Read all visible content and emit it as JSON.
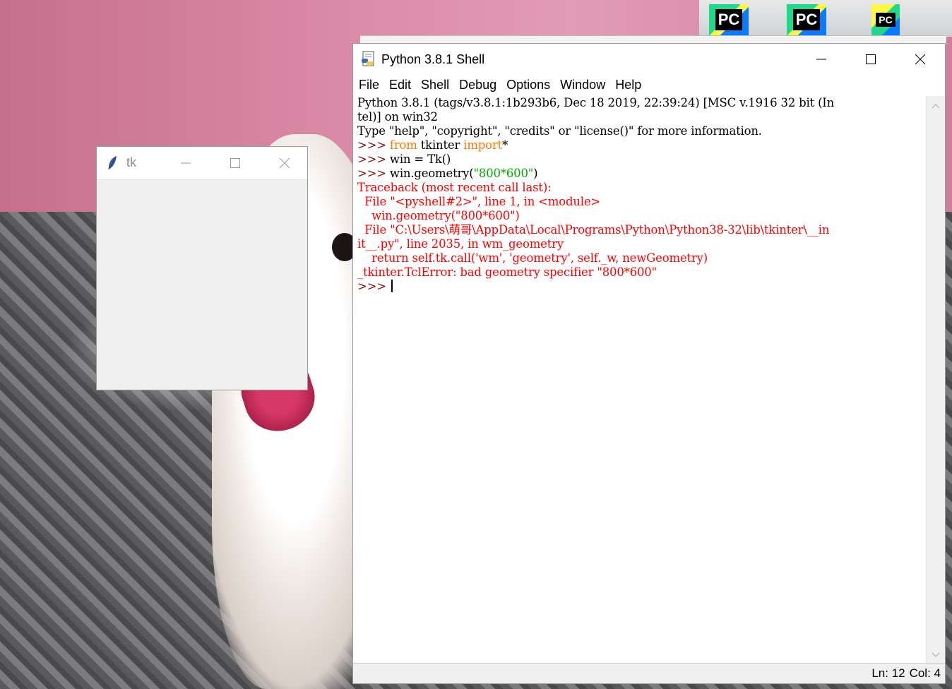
{
  "desktop": {
    "icons": [
      {
        "name": "pycharm-icon-1",
        "label": "PC"
      },
      {
        "name": "pycharm-icon-2",
        "label": "PC"
      },
      {
        "name": "pycharm-icon-3",
        "label": "PC"
      }
    ]
  },
  "tk_window": {
    "title": "tk",
    "buttons": {
      "minimize": "—",
      "maximize": "☐",
      "close": "✕"
    }
  },
  "shell": {
    "title": "Python 3.8.1 Shell",
    "window_buttons": {
      "minimize": "—",
      "maximize": "☐",
      "close": "✕"
    },
    "menu": [
      "File",
      "Edit",
      "Shell",
      "Debug",
      "Options",
      "Window",
      "Help"
    ],
    "lines": [
      {
        "segments": [
          {
            "text": "Python 3.8.1 (tags/v3.8.1:1b293b6, Dec 18 2019, 22:39:24) [MSC v.1916 32 bit (In",
            "style": "norm"
          }
        ]
      },
      {
        "segments": [
          {
            "text": "tel)] on win32",
            "style": "norm"
          }
        ]
      },
      {
        "segments": [
          {
            "text": "Type \"help\", \"copyright\", \"credits\" or \"license()\" for more information.",
            "style": "norm"
          }
        ]
      },
      {
        "segments": [
          {
            "text": ">>> ",
            "style": "prompt"
          },
          {
            "text": "from",
            "style": "kw"
          },
          {
            "text": " tkinter ",
            "style": "norm"
          },
          {
            "text": "import",
            "style": "kw"
          },
          {
            "text": "*",
            "style": "norm"
          }
        ]
      },
      {
        "segments": [
          {
            "text": ">>> ",
            "style": "prompt"
          },
          {
            "text": "win = Tk()",
            "style": "norm"
          }
        ]
      },
      {
        "segments": [
          {
            "text": ">>> ",
            "style": "prompt"
          },
          {
            "text": "win.geometry(",
            "style": "norm"
          },
          {
            "text": "\"800*600\"",
            "style": "str"
          },
          {
            "text": ")",
            "style": "norm"
          }
        ]
      },
      {
        "segments": [
          {
            "text": "Traceback (most recent call last):",
            "style": "err"
          }
        ]
      },
      {
        "segments": [
          {
            "text": "  File \"<pyshell#2>\", line 1, in <module>",
            "style": "err"
          }
        ]
      },
      {
        "segments": [
          {
            "text": "    win.geometry(\"800*600\")",
            "style": "err"
          }
        ]
      },
      {
        "segments": [
          {
            "text": "  File \"C:\\Users\\萌哥\\AppData\\Local\\Programs\\Python\\Python38-32\\lib\\tkinter\\__in",
            "style": "err"
          }
        ]
      },
      {
        "segments": [
          {
            "text": "it__.py\", line 2035, in wm_geometry",
            "style": "err"
          }
        ]
      },
      {
        "segments": [
          {
            "text": "    return self.tk.call('wm', 'geometry', self._w, newGeometry)",
            "style": "err"
          }
        ]
      },
      {
        "segments": [
          {
            "text": "_tkinter.TclError: bad geometry specifier \"800*600\"",
            "style": "err"
          }
        ]
      },
      {
        "segments": [
          {
            "text": ">>> ",
            "style": "prompt"
          }
        ],
        "cursor": true
      }
    ],
    "status": {
      "line": "Ln: 12",
      "col": "Col: 4"
    }
  }
}
